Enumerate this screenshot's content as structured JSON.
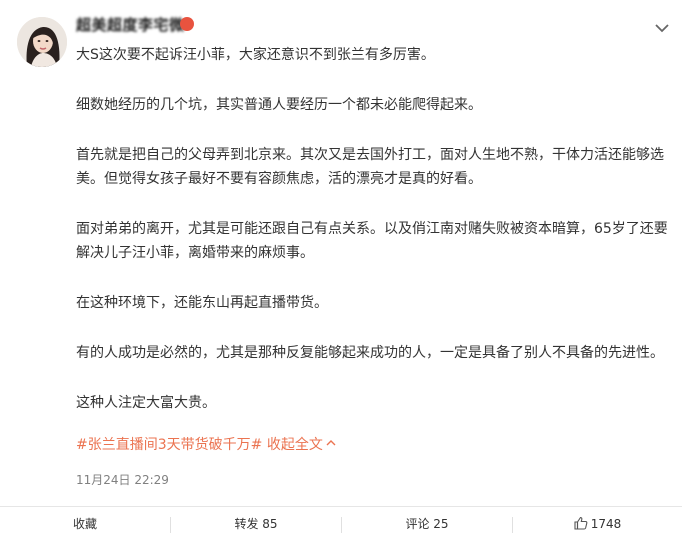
{
  "author": {
    "name": "超美超度李宅微"
  },
  "post": {
    "paragraphs": [
      "大S这次要不起诉汪小菲，大家还意识不到张兰有多厉害。",
      "细数她经历的几个坑，其实普通人要经历一个都未必能爬得起来。",
      "首先就是把自己的父母弄到北京来。其次又是去国外打工，面对人生地不熟，干体力活还能够选美。但觉得女孩子最好不要有容颜焦虑，活的漂亮才是真的好看。",
      "面对弟弟的离开，尤其是可能还跟自己有点关系。以及俏江南对赌失败被资本暗算，65岁了还要解决儿子汪小菲，离婚带来的麻烦事。",
      "在这种环境下，还能东山再起直播带货。",
      "有的人成功是必然的，尤其是那种反复能够起来成功的人，一定是具备了别人不具备的先进性。",
      "这种人注定大富大贵。"
    ],
    "hashtag": "#张兰直播间3天带货破千万#",
    "collapse_label": "收起全文",
    "timestamp": "11月24日 22:29"
  },
  "actions": {
    "favorite": "收藏",
    "repost": "转发 85",
    "comment": "评论 25",
    "like": "1748"
  },
  "colors": {
    "link": "#eb7350",
    "muted": "#808080"
  }
}
